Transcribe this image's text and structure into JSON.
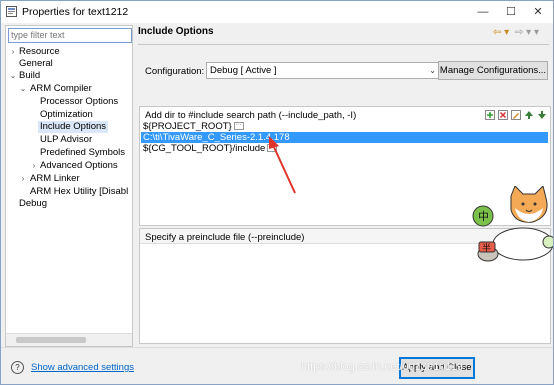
{
  "window": {
    "title": "Properties for text1212",
    "min_label": "—",
    "max_label": "☐",
    "close_label": "✕"
  },
  "filter": {
    "placeholder": "type filter text"
  },
  "tree": [
    {
      "label": "Resource",
      "toggle": "›"
    },
    {
      "label": "General",
      "toggle": ""
    },
    {
      "label": "Build",
      "toggle": "⌄"
    },
    {
      "label": "ARM Compiler",
      "toggle": "⌄"
    },
    {
      "label": "Processor Options",
      "toggle": ""
    },
    {
      "label": "Optimization",
      "toggle": ""
    },
    {
      "label": "Include Options",
      "toggle": "",
      "selected": true
    },
    {
      "label": "ULP Advisor",
      "toggle": ""
    },
    {
      "label": "Predefined Symbols",
      "toggle": ""
    },
    {
      "label": "Advanced Options",
      "toggle": "›"
    },
    {
      "label": "ARM Linker",
      "toggle": "›"
    },
    {
      "label": "ARM Hex Utility  [Disabl",
      "toggle": ""
    },
    {
      "label": "Debug",
      "toggle": ""
    }
  ],
  "right": {
    "heading": "Include Options",
    "nav_back": "⇦ ▾",
    "nav_fwd": "⇨ ▾ ▾",
    "configuration_label": "Configuration:",
    "configuration_value": "Debug  [ Active ]",
    "manage_button": "Manage Configurations..."
  },
  "include_panel": {
    "header": "Add dir to #include search path (--include_path, -I)",
    "items": [
      {
        "text": "${PROJECT_ROOT}",
        "selected": false
      },
      {
        "text": "C:\\ti\\TivaWare_C_Series-2.1.4.178",
        "selected": true
      },
      {
        "text": "${CG_TOOL_ROOT}/include",
        "selected": false
      }
    ]
  },
  "preinclude_panel": {
    "header": "Specify a preinclude file (--preinclude)"
  },
  "footer": {
    "help": "?",
    "advanced_link": "Show advanced settings",
    "apply_close": "Apply and Close",
    "watermark": "https://blog.csdn.net/u013910119"
  },
  "colors": {
    "selection": "#3399ff",
    "link": "#0066cc",
    "annotation_arrow": "#e0342b"
  },
  "icons": [
    "app-icon",
    "add-icon",
    "delete-icon",
    "edit-icon",
    "move-up-icon",
    "move-down-icon",
    "help-icon",
    "cat-sticker"
  ]
}
